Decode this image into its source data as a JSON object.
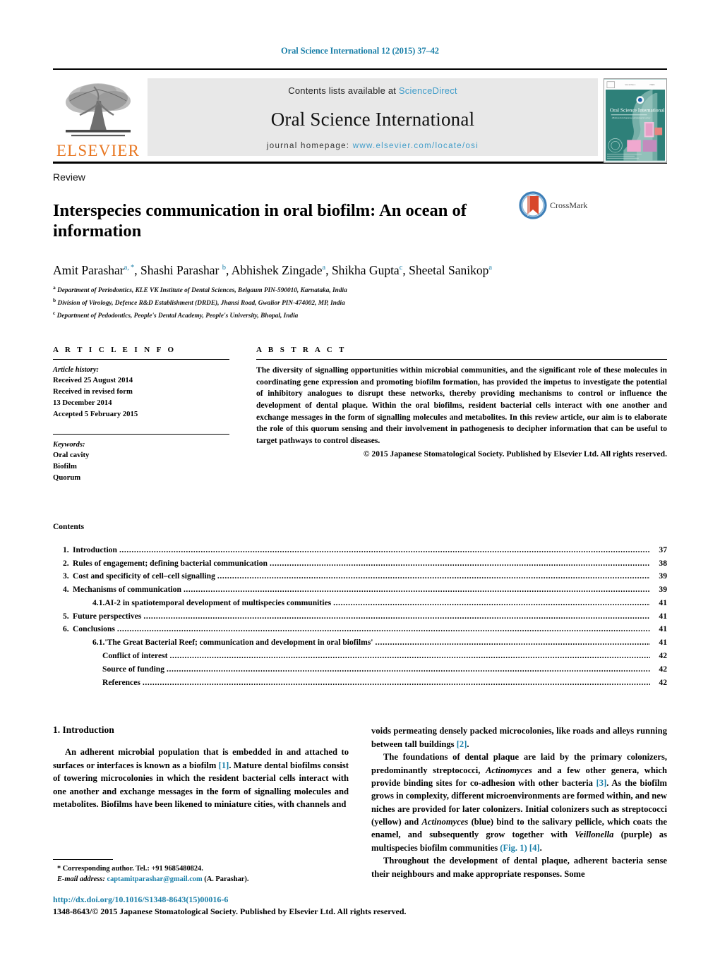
{
  "running_head": "Oral Science International 12 (2015) 37–42",
  "masthead": {
    "elsevier_wordmark": "ELSEVIER",
    "contents_prefix": "Contents lists available at ",
    "sciencedirect": "ScienceDirect",
    "journal_name": "Oral Science International",
    "homepage_prefix": "journal homepage: ",
    "homepage_url": "www.elsevier.com/locate/osi",
    "cover_caption": "Oral Science International",
    "accent_link_color": "#3f9cc9",
    "elsevier_orange": "#E87722"
  },
  "article": {
    "type": "Review",
    "title": "Interspecies communication in oral biofilm: An ocean of information",
    "crossmark_label": "CrossMark",
    "authors_html": "Amit Parashar<sup>a, *</sup>, Shashi Parashar <sup>b</sup>, Abhishek Zingade<sup>a</sup>, Shikha Gupta<sup>c</sup>, Sheetal Sanikop<sup>a</sup>",
    "affiliations": [
      "Department of Periodontics, KLE VK Institute of Dental Sciences, Belgaum PIN-590010, Karnataka, India",
      "Division of Virology, Defence R&D Establishment (DRDE), Jhansi Road, Gwalior PIN-474002, MP, India",
      "Department of Pedodontics, People's Dental Academy, People's University, Bhopal, India"
    ],
    "affiliation_markers": [
      "a",
      "b",
      "c"
    ]
  },
  "article_info": {
    "heading": "A R T I C L E   I N F O",
    "history_label": "Article history:",
    "history": [
      "Received 25 August 2014",
      "Received in revised form",
      "13 December 2014",
      "Accepted 5 February 2015"
    ],
    "keywords_label": "Keywords:",
    "keywords": [
      "Oral cavity",
      "Biofilm",
      "Quorum"
    ]
  },
  "abstract": {
    "heading": "A B S T R A C T",
    "text": "The diversity of signalling opportunities within microbial communities, and the significant role of these molecules in coordinating gene expression and promoting biofilm formation, has provided the impetus to investigate the potential of inhibitory analogues to disrupt these networks, thereby providing mechanisms to control or influence the development of dental plaque. Within the oral biofilms, resident bacterial cells interact with one another and exchange messages in the form of signalling molecules and metabolites. In this review article, our aim is to elaborate the role of this quorum sensing and their involvement in pathogenesis to decipher information that can be useful to target pathways to control diseases.",
    "copyright": "© 2015 Japanese Stomatological Society. Published by Elsevier Ltd. All rights reserved."
  },
  "contents": {
    "title": "Contents",
    "entries": [
      {
        "num": "1.",
        "label": "Introduction",
        "page": "37",
        "level": 1
      },
      {
        "num": "2.",
        "label": "Rules of engagement; defining bacterial communication",
        "page": "38",
        "level": 1
      },
      {
        "num": "3.",
        "label": "Cost and specificity of cell–cell signalling",
        "page": "39",
        "level": 1
      },
      {
        "num": "4.",
        "label": "Mechanisms of communication",
        "page": "39",
        "level": 1
      },
      {
        "num": "4.1.",
        "label": "AI-2 in spatiotemporal development of multispecies communities",
        "page": "41",
        "level": 2
      },
      {
        "num": "5.",
        "label": "Future perspectives",
        "page": "41",
        "level": 1
      },
      {
        "num": "6.",
        "label": "Conclusions",
        "page": "41",
        "level": 1
      },
      {
        "num": "6.1.",
        "label": "'The Great Bacterial Reef; communication and development in oral biofilms'",
        "page": "41",
        "level": 2
      },
      {
        "num": "",
        "label": "Conflict of interest",
        "page": "42",
        "level": 2
      },
      {
        "num": "",
        "label": "Source of funding",
        "page": "42",
        "level": 2
      },
      {
        "num": "",
        "label": "References",
        "page": "42",
        "level": 2
      }
    ]
  },
  "body": {
    "section_title": "1.  Introduction",
    "left_paragraph_html": "An adherent microbial population that is embedded in and attached to surfaces or interfaces is known as a biofilm <span class=\"ref\">[1]</span>. Mature dental biofilms consist of towering microcolonies in which the resident bacterial cells interact with one another and exchange messages in the form of signalling molecules and metabolites. Biofilms have been likened to miniature cities, with channels and",
    "right_paragraph_1_html": "voids permeating densely packed microcolonies, like roads and alleys running between tall buildings <span class=\"ref\">[2]</span>.",
    "right_paragraph_2_html": "The foundations of dental plaque are laid by the primary colonizers, predominantly streptococci, <span class=\"ital\">Actinomyces</span> and a few other genera, which provide binding sites for co-adhesion with other bacteria <span class=\"ref\">[3]</span>. As the biofilm grows in complexity, different microenvironments are formed within, and new niches are provided for later colonizers. Initial colonizers such as streptococci (yellow) and <span class=\"ital\">Actinomyces</span> (blue) bind to the salivary pellicle, which coats the enamel, and subsequently grow together with <span class=\"ital\">Veillonella</span> (purple) as multispecies biofilm communities <span class=\"ref\">(Fig. 1)</span> <span class=\"ref\">[4]</span>.",
    "right_paragraph_3_html": "Throughout the development of dental plaque, adherent bacteria sense their neighbours and make appropriate responses. Some"
  },
  "footnote": {
    "corresponding_html": "*  Corresponding author. Tel.: +91 9685480824.",
    "email_label": "E-mail address:",
    "email": "captamitparashar@gmail.com",
    "email_suffix": "(A. Parashar)."
  },
  "footer": {
    "doi": "http://dx.doi.org/10.1016/S1348-8643(15)00016-6",
    "issn_line": "1348-8643/© 2015 Japanese Stomatological Society. Published by Elsevier Ltd. All rights reserved."
  }
}
